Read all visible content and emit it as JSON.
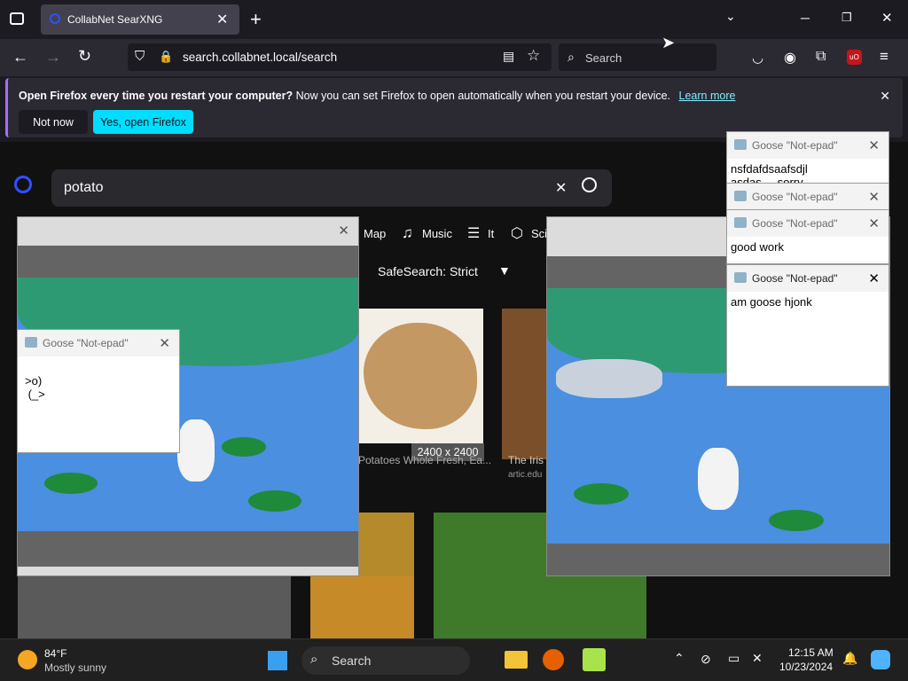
{
  "browser": {
    "tab_title": "CollabNet SearXNG",
    "url": "search.collabnet.local/search",
    "search_placeholder": "Search"
  },
  "notification": {
    "bold": "Open Firefox every time you restart your computer?",
    "text": " Now you can set Firefox to open automatically when you restart your device.",
    "link": "Learn more",
    "not_now": "Not now",
    "yes": "Yes, open Firefox"
  },
  "search": {
    "query": "potato",
    "categories": [
      "Map",
      "Music",
      "It",
      "Sci"
    ],
    "safesearch": "SafeSearch: Strict",
    "result_dim": "2400 x 2400",
    "result_title": "Potatoes Whole Fresh, Ea...",
    "result2_title": "The Iris",
    "result2_source": "artic.edu"
  },
  "notes": [
    {
      "title": "Goose \"Not-epad\"",
      "body": "nsfdafdsaafsdjl\nasdas     sorry"
    },
    {
      "title": "Goose \"Not-epad\"",
      "body": ""
    },
    {
      "title": "Goose \"Not-epad\"",
      "body": "good work"
    },
    {
      "title": "Goose \"Not-epad\"",
      "body": "am goose hjonk"
    },
    {
      "title": "Goose \"Not-epad\"",
      "body": ">o)\n (_>"
    }
  ],
  "taskbar": {
    "temp": "84°F",
    "weather": "Mostly sunny",
    "search": "Search",
    "time": "12:15 AM",
    "date": "10/23/2024"
  },
  "colors": {
    "accent": "#00ddff",
    "firefox_purple": "#a86cff",
    "search_blue": "#3050ff"
  }
}
